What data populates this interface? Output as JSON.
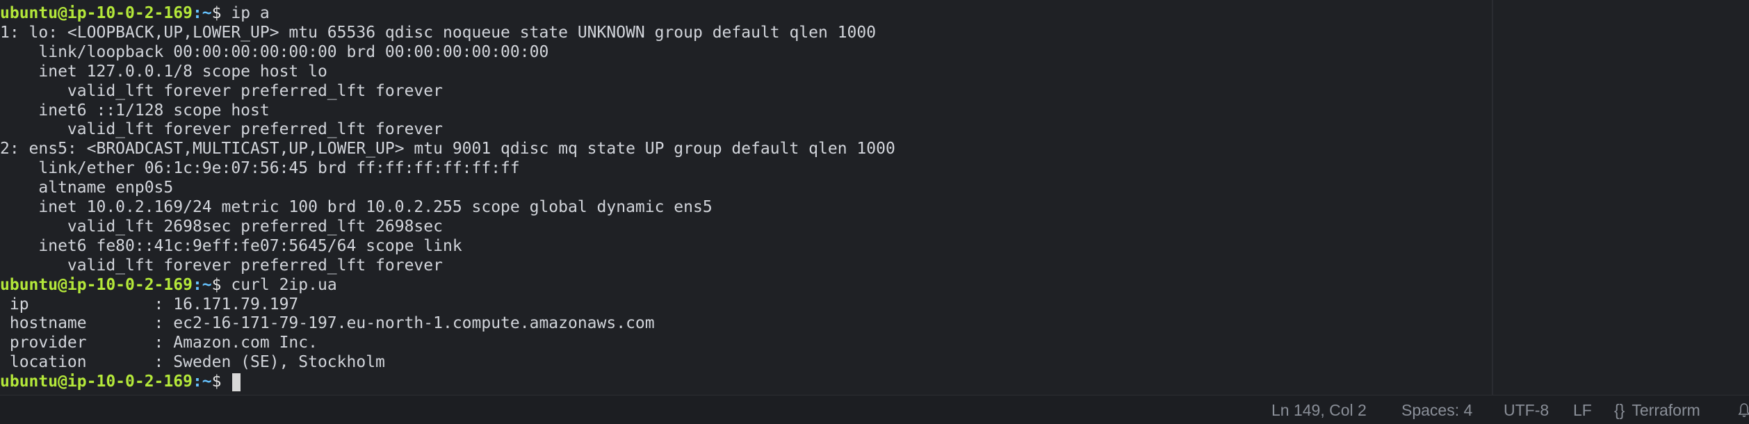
{
  "terminal": {
    "prompt": {
      "user_host": "ubuntu@ip-10-0-2-169",
      "path": ":~",
      "sign": "$ "
    },
    "lines": [
      {
        "type": "prompt",
        "cmd": "ip a"
      },
      {
        "type": "out",
        "text": "1: lo: <LOOPBACK,UP,LOWER_UP> mtu 65536 qdisc noqueue state UNKNOWN group default qlen 1000"
      },
      {
        "type": "out",
        "text": "    link/loopback 00:00:00:00:00:00 brd 00:00:00:00:00:00"
      },
      {
        "type": "out",
        "text": "    inet 127.0.0.1/8 scope host lo"
      },
      {
        "type": "out",
        "text": "       valid_lft forever preferred_lft forever"
      },
      {
        "type": "out",
        "text": "    inet6 ::1/128 scope host"
      },
      {
        "type": "out",
        "text": "       valid_lft forever preferred_lft forever"
      },
      {
        "type": "out",
        "text": "2: ens5: <BROADCAST,MULTICAST,UP,LOWER_UP> mtu 9001 qdisc mq state UP group default qlen 1000"
      },
      {
        "type": "out",
        "text": "    link/ether 06:1c:9e:07:56:45 brd ff:ff:ff:ff:ff:ff"
      },
      {
        "type": "out",
        "text": "    altname enp0s5"
      },
      {
        "type": "out",
        "text": "    inet 10.0.2.169/24 metric 100 brd 10.0.2.255 scope global dynamic ens5"
      },
      {
        "type": "out",
        "text": "       valid_lft 2698sec preferred_lft 2698sec"
      },
      {
        "type": "out",
        "text": "    inet6 fe80::41c:9eff:fe07:5645/64 scope link"
      },
      {
        "type": "out",
        "text": "       valid_lft forever preferred_lft forever"
      },
      {
        "type": "prompt",
        "cmd": "curl 2ip.ua"
      },
      {
        "type": "out",
        "text": " ip             : 16.171.79.197"
      },
      {
        "type": "out",
        "text": " hostname       : ec2-16-171-79-197.eu-north-1.compute.amazonaws.com"
      },
      {
        "type": "out",
        "text": " provider       : Amazon.com Inc."
      },
      {
        "type": "out",
        "text": " location       : Sweden (SE), Stockholm"
      },
      {
        "type": "prompt-cursor",
        "cmd": ""
      }
    ]
  },
  "status_bar": {
    "position": "Ln 149, Col 2",
    "spaces": "Spaces: 4",
    "encoding": "UTF-8",
    "eol": "LF",
    "language_icon": "{}",
    "language": "Terraform",
    "bell_icon": "bell-icon"
  }
}
